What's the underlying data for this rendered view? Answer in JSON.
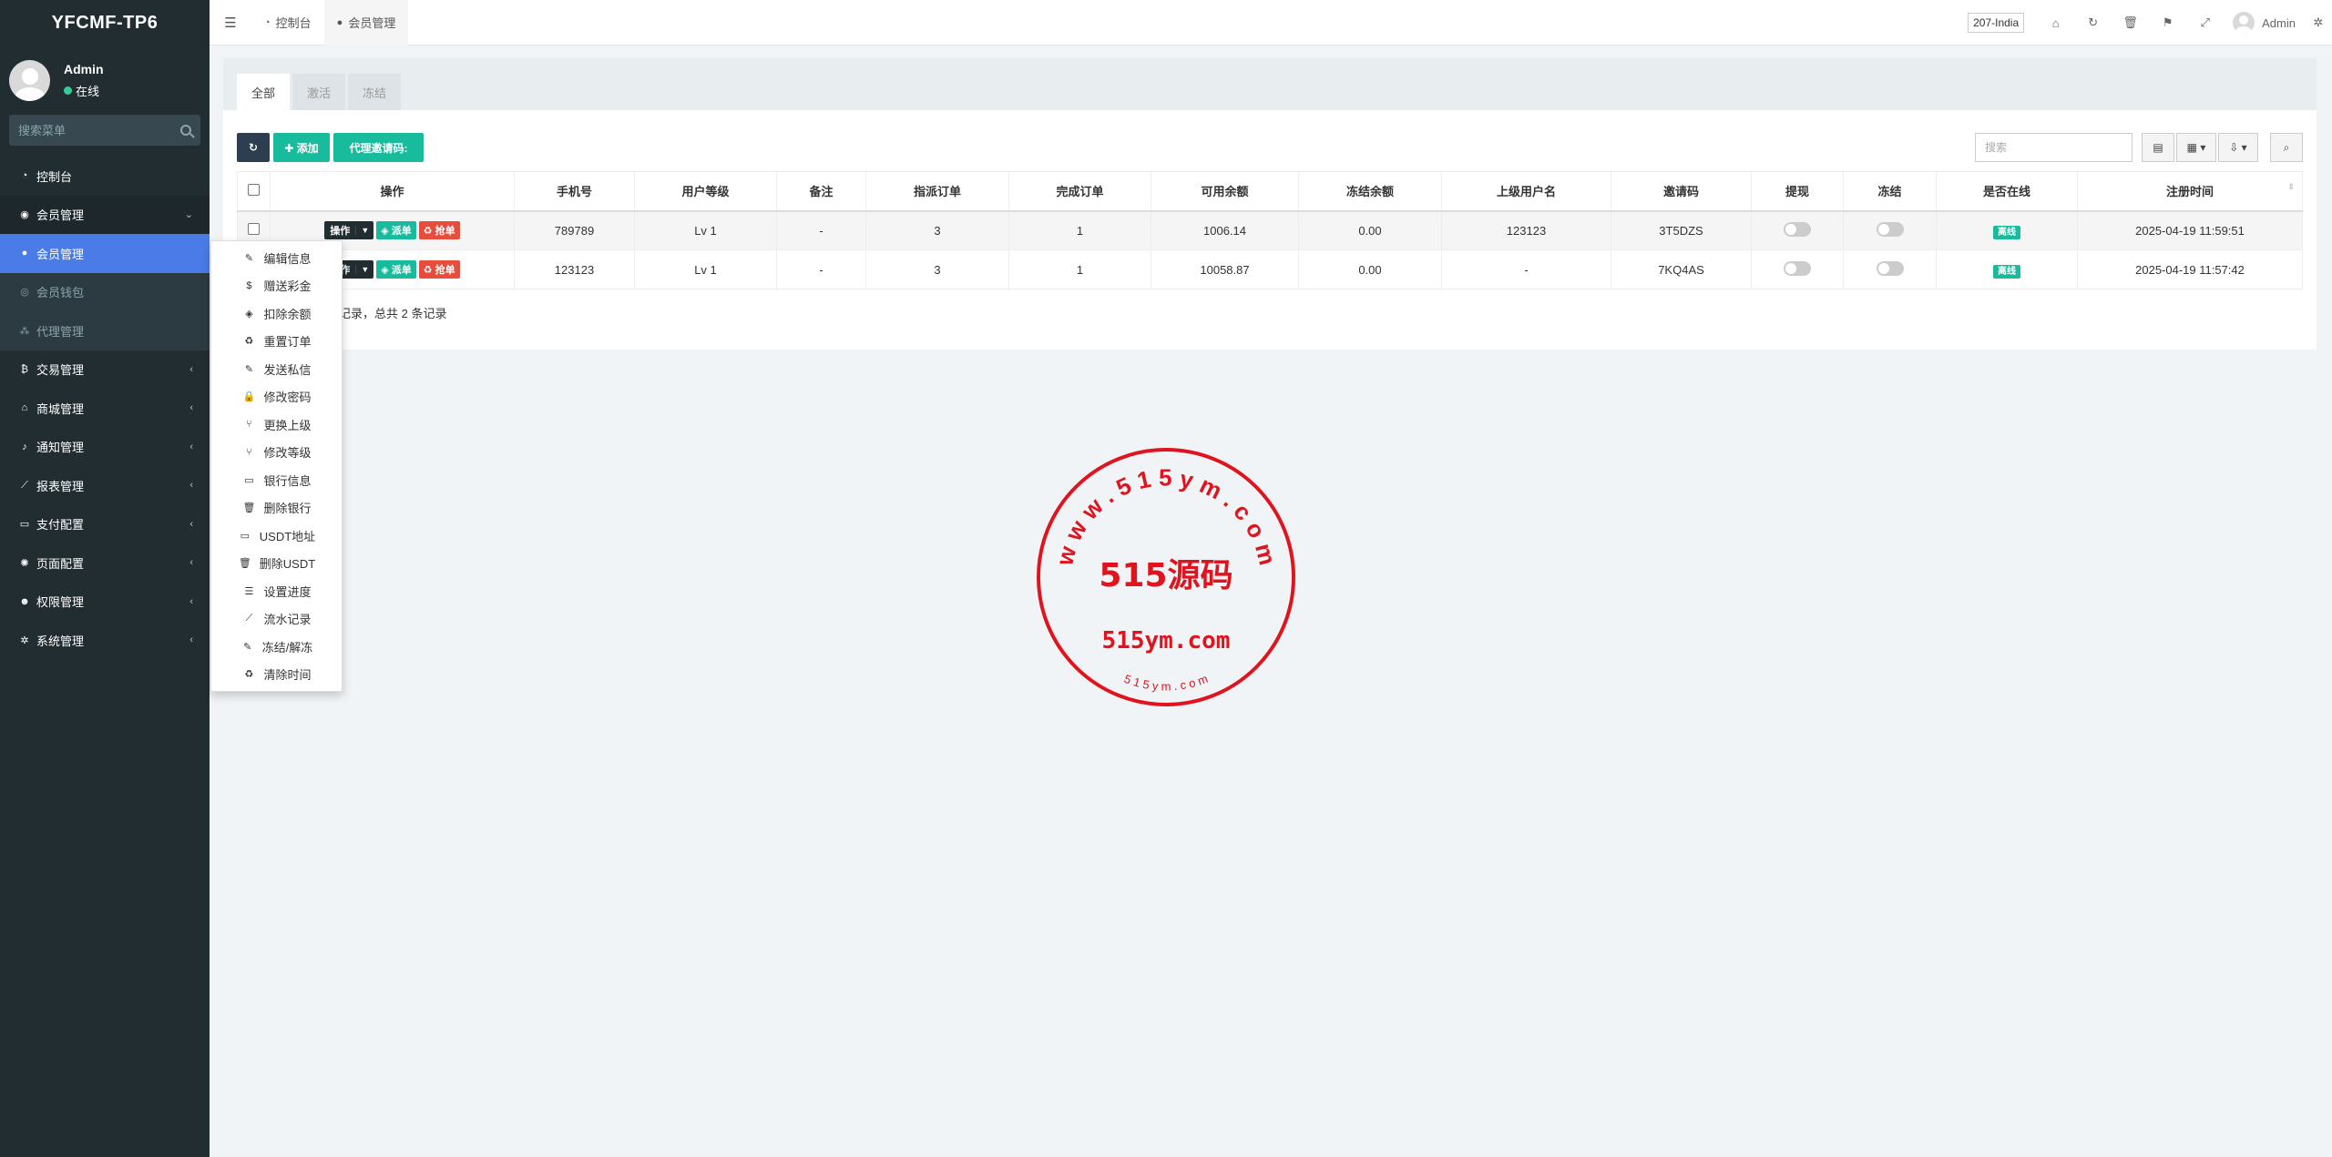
{
  "brand": {
    "logo": "YFCMF-TP6"
  },
  "user": {
    "name": "Admin",
    "status": "在线"
  },
  "sidebar": {
    "search_placeholder": "搜索菜单",
    "items": [
      {
        "label": "控制台",
        "icon": "dashboard-icon"
      },
      {
        "label": "会员管理",
        "icon": "user-circle-icon",
        "open": true
      },
      {
        "label": "交易管理",
        "icon": "bitcoin-icon"
      },
      {
        "label": "商城管理",
        "icon": "home-icon"
      },
      {
        "label": "通知管理",
        "icon": "bell-icon"
      },
      {
        "label": "报表管理",
        "icon": "line-chart-icon"
      },
      {
        "label": "支付配置",
        "icon": "credit-card-icon"
      },
      {
        "label": "页面配置",
        "icon": "gear-icon"
      },
      {
        "label": "权限管理",
        "icon": "users-icon"
      },
      {
        "label": "系统管理",
        "icon": "cogs-icon"
      }
    ],
    "sub_items": [
      {
        "label": "会员管理",
        "icon": "user-icon",
        "active": true
      },
      {
        "label": "会员钱包",
        "icon": "globe-icon"
      },
      {
        "label": "代理管理",
        "icon": "sitemap-icon"
      }
    ]
  },
  "header": {
    "tabs": [
      {
        "label": "控制台",
        "icon": "dashboard-icon"
      },
      {
        "label": "会员管理",
        "icon": "user-icon"
      }
    ],
    "region": "207-India",
    "admin": "Admin"
  },
  "panel": {
    "tabs": [
      "全部",
      "激活",
      "冻结"
    ],
    "toolbar": {
      "add_label": "✚ 添加",
      "invite_label": "代理邀请码:",
      "search_placeholder": "搜索"
    },
    "columns": [
      "操作",
      "手机号",
      "用户等级",
      "备注",
      "指派订单",
      "完成订单",
      "可用余额",
      "冻结余额",
      "上级用户名",
      "邀请码",
      "提现",
      "冻结",
      "是否在线",
      "注册时间"
    ],
    "row_buttons": {
      "op": "操作",
      "dispatch": "派单",
      "rob": "抢单"
    },
    "rows": [
      {
        "phone": "789789",
        "level": "Lv 1",
        "note": "-",
        "assigned": "3",
        "completed": "1",
        "balance": "1006.14",
        "frozen": "0.00",
        "parent": "123123",
        "invite": "3T5DZS",
        "online": "离线",
        "registered": "2025-04-19 11:59:51"
      },
      {
        "phone": "123123",
        "level": "Lv 1",
        "note": "-",
        "assigned": "3",
        "completed": "1",
        "balance": "10058.87",
        "frozen": "0.00",
        "parent": "-",
        "invite": "7KQ4AS",
        "online": "离线",
        "registered": "2025-04-19 11:57:42"
      }
    ],
    "pagination_info": "记录，总共 2 条记录"
  },
  "dropdown": [
    {
      "label": "编辑信息",
      "icon": "pencil-icon"
    },
    {
      "label": "赠送彩金",
      "icon": "dollar-icon"
    },
    {
      "label": "扣除余额",
      "icon": "shield-icon"
    },
    {
      "label": "重置订单",
      "icon": "recycle-icon"
    },
    {
      "label": "发送私信",
      "icon": "pencil-icon"
    },
    {
      "label": "修改密码",
      "icon": "lock-icon"
    },
    {
      "label": "更换上级",
      "icon": "code-fork-icon"
    },
    {
      "label": "修改等级",
      "icon": "code-fork-icon"
    },
    {
      "label": "银行信息",
      "icon": "credit-card-icon"
    },
    {
      "label": "删除银行",
      "icon": "trash-icon"
    },
    {
      "label": "USDT地址",
      "icon": "credit-card-icon"
    },
    {
      "label": "删除USDT",
      "icon": "trash-icon"
    },
    {
      "label": "设置进度",
      "icon": "sliders-icon"
    },
    {
      "label": "流水记录",
      "icon": "line-chart-icon"
    },
    {
      "label": "冻结/解冻",
      "icon": "pencil-icon"
    },
    {
      "label": "清除时间",
      "icon": "recycle-icon"
    }
  ],
  "stamp": {
    "ring_text": "w w w . 5 1 5 y m . c o m",
    "center_text": "515源码",
    "url_text": "515ym.com",
    "bottom_text": "5 1 5 y m . c o m",
    "color": "#e0141e"
  }
}
